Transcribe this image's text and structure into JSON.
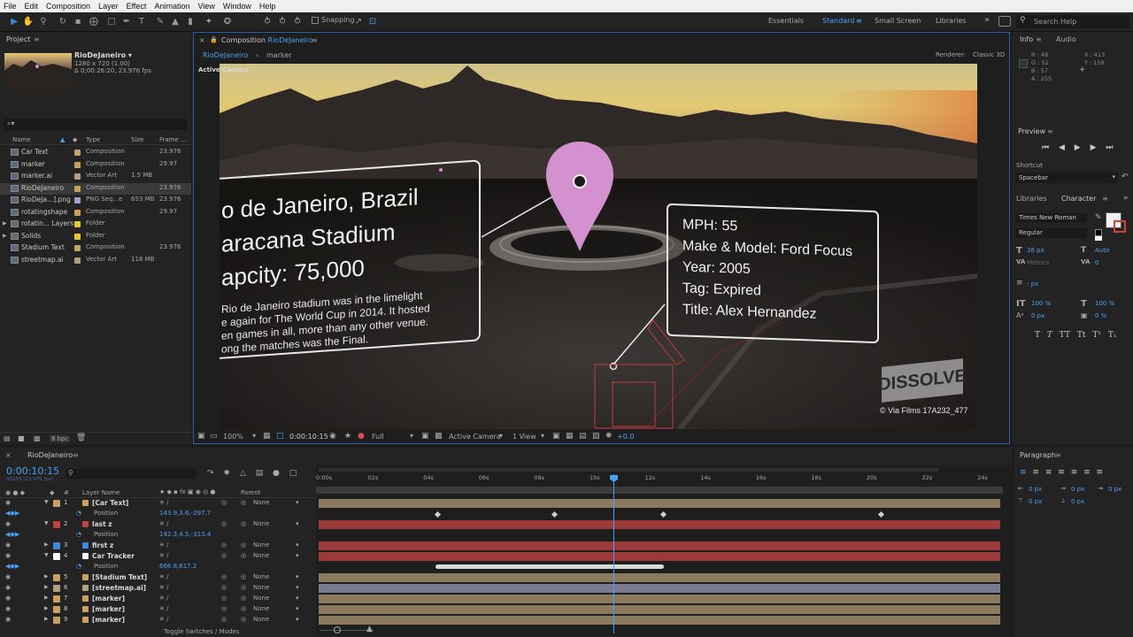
{
  "menu": [
    "File",
    "Edit",
    "Composition",
    "Layer",
    "Effect",
    "Animation",
    "View",
    "Window",
    "Help"
  ],
  "toolbar": {
    "snapping_label": "Snapping",
    "workspaces": [
      "Essentials",
      "Standard",
      "Small Screen",
      "Libraries"
    ],
    "active_workspace": "Standard",
    "search_placeholder": "Search Help"
  },
  "project": {
    "title": "Project",
    "comp_name": "RioDeJaneiro ▾",
    "comp_info1": "1280 x 720 (1.00)",
    "comp_info2": "Δ 0;00:26:20, 23.976 fps",
    "search_placeholder": "⌕▾",
    "columns": [
      "Name",
      "Type",
      "Size",
      "Frame ..."
    ],
    "items": [
      {
        "name": "Car Text",
        "type": "Composition",
        "size": "",
        "fps": "23.976",
        "color": "#c8a060",
        "icon": "comp"
      },
      {
        "name": "marker",
        "type": "Composition",
        "size": "",
        "fps": "29.97",
        "color": "#c8a060",
        "icon": "comp"
      },
      {
        "name": "marker.ai",
        "type": "Vector Art",
        "size": "1.5 MB",
        "fps": "",
        "color": "#b0a080",
        "icon": "file"
      },
      {
        "name": "RioDeJaneiro",
        "type": "Composition",
        "size": "",
        "fps": "23.976",
        "color": "#c8a060",
        "icon": "comp"
      },
      {
        "name": "RioDeJa...].png",
        "type": "PNG Seq...e",
        "size": "653 MB",
        "fps": "23.976",
        "color": "#a0a0d0",
        "icon": "file"
      },
      {
        "name": "rotatingshape",
        "type": "Composition",
        "size": "",
        "fps": "29.97",
        "color": "#c8a060",
        "icon": "comp"
      },
      {
        "name": "rotatin... Layers",
        "type": "Folder",
        "size": "",
        "fps": "",
        "color": "#e8c830",
        "icon": "folder"
      },
      {
        "name": "Solids",
        "type": "Folder",
        "size": "",
        "fps": "",
        "color": "#e8c830",
        "icon": "folder"
      },
      {
        "name": "Stadium Text",
        "type": "Composition",
        "size": "",
        "fps": "23.976",
        "color": "#c8a060",
        "icon": "comp"
      },
      {
        "name": "streetmap.ai",
        "type": "Vector Art",
        "size": "118 MB",
        "fps": "",
        "color": "#b0a080",
        "icon": "file"
      }
    ],
    "bpc": "8 bpc"
  },
  "composition": {
    "panel_title": "Composition",
    "panel_comp": "RioDeJaneiro",
    "breadcrumb": [
      "RioDeJaneiro",
      "marker"
    ],
    "renderer_label": "Renderer:",
    "renderer": "Classic 3D",
    "camera_label": "Active Camera",
    "stadium_card": [
      "o de Janeiro, Brazil",
      "aracana Stadium",
      "apcity: 75,000"
    ],
    "stadium_paragraph": [
      "Rio de Janeiro stadium was in the limelight",
      "e again for The World Cup in 2014. It hosted",
      "en games in all, more than any other venue.",
      "ong the matches was the Final."
    ],
    "car_card": [
      "MPH: 55",
      "Make & Model: Ford Focus",
      "Year: 2005",
      "Tag: Expired",
      "Title: Alex Hernandez"
    ],
    "watermark": "DISSOLVE",
    "credit": "© Via Films 17A232_477",
    "footer": {
      "zoom": "100%",
      "time": "0:00:10:15",
      "resolution": "Full",
      "camera": "Active Camera",
      "view": "1 View",
      "exposure": "+0.0"
    }
  },
  "info": {
    "tabs": [
      "Info",
      "Audio"
    ],
    "r": "R : 48",
    "g": "G : 52",
    "b": "B : 57",
    "a": "A : 255",
    "x": "X : 413",
    "y": "Y : 158"
  },
  "preview": {
    "title": "Preview",
    "shortcut_label": "Shortcut",
    "shortcut": "Spacebar"
  },
  "character": {
    "tabs": [
      "Libraries",
      "Character"
    ],
    "font": "Times New Roman",
    "style": "Regular",
    "size": "36 px",
    "leading": "Auto",
    "kerning": "Metrics",
    "tracking": "0",
    "stroke": "- px",
    "vscale": "100 %",
    "hscale": "100 %",
    "baseline": "0 px",
    "tsume": "0 %",
    "styles": [
      "T",
      "T",
      "TT",
      "Tt",
      "T¹",
      "T₁"
    ]
  },
  "paragraph": {
    "title": "Paragraph",
    "values": [
      "0 px",
      "0 px",
      "0 px",
      "0 px",
      "0 px"
    ]
  },
  "timeline": {
    "tab": "RioDeJaneiro",
    "time": "0:00:10:15",
    "frames": "00255 (23.976 fps)",
    "columns": {
      "layer": "Layer Name",
      "parent": "Parent"
    },
    "ruler": [
      "0:00s",
      "02s",
      "04s",
      "06s",
      "08s",
      "10s",
      "12s",
      "14s",
      "16s",
      "18s",
      "20s",
      "22s",
      "24s"
    ],
    "layers": [
      {
        "num": "1",
        "name": "[Car Text]",
        "color": "#c8a060",
        "parent": "None",
        "bar": "#8a7a60",
        "expanded": true
      },
      {
        "num": "",
        "name": "Position",
        "value": "143.9,3.6,-297.7",
        "sub": true
      },
      {
        "num": "2",
        "name": "last z",
        "color": "#c04040",
        "parent": "None",
        "bar": "#9a3a3a",
        "expanded": true
      },
      {
        "num": "",
        "name": "Position",
        "value": "142.3,4.5,-313.4",
        "sub": true
      },
      {
        "num": "3",
        "name": "first z",
        "color": "#3d8bd8",
        "parent": "None",
        "bar": "#9a3a3a"
      },
      {
        "num": "4",
        "name": "Car Tracker",
        "color": "#ffffff",
        "parent": "None",
        "bar": "#9a3a3a",
        "expanded": true
      },
      {
        "num": "",
        "name": "Position",
        "value": "666.8,617.2",
        "sub": true
      },
      {
        "num": "5",
        "name": "[Stadium Text]",
        "color": "#c8a060",
        "parent": "None",
        "bar": "#8a7a60"
      },
      {
        "num": "6",
        "name": "[streetmap.ai]",
        "color": "#b0a080",
        "parent": "None",
        "bar": "#7a7a90"
      },
      {
        "num": "7",
        "name": "[marker]",
        "color": "#c8a060",
        "parent": "None",
        "bar": "#8a7a60"
      },
      {
        "num": "8",
        "name": "[marker]",
        "color": "#c8a060",
        "parent": "None",
        "bar": "#8a7a60"
      },
      {
        "num": "9",
        "name": "[marker]",
        "color": "#c8a060",
        "parent": "None",
        "bar": "#8a7a60"
      }
    ],
    "toggle_label": "Toggle Switches / Modes"
  }
}
